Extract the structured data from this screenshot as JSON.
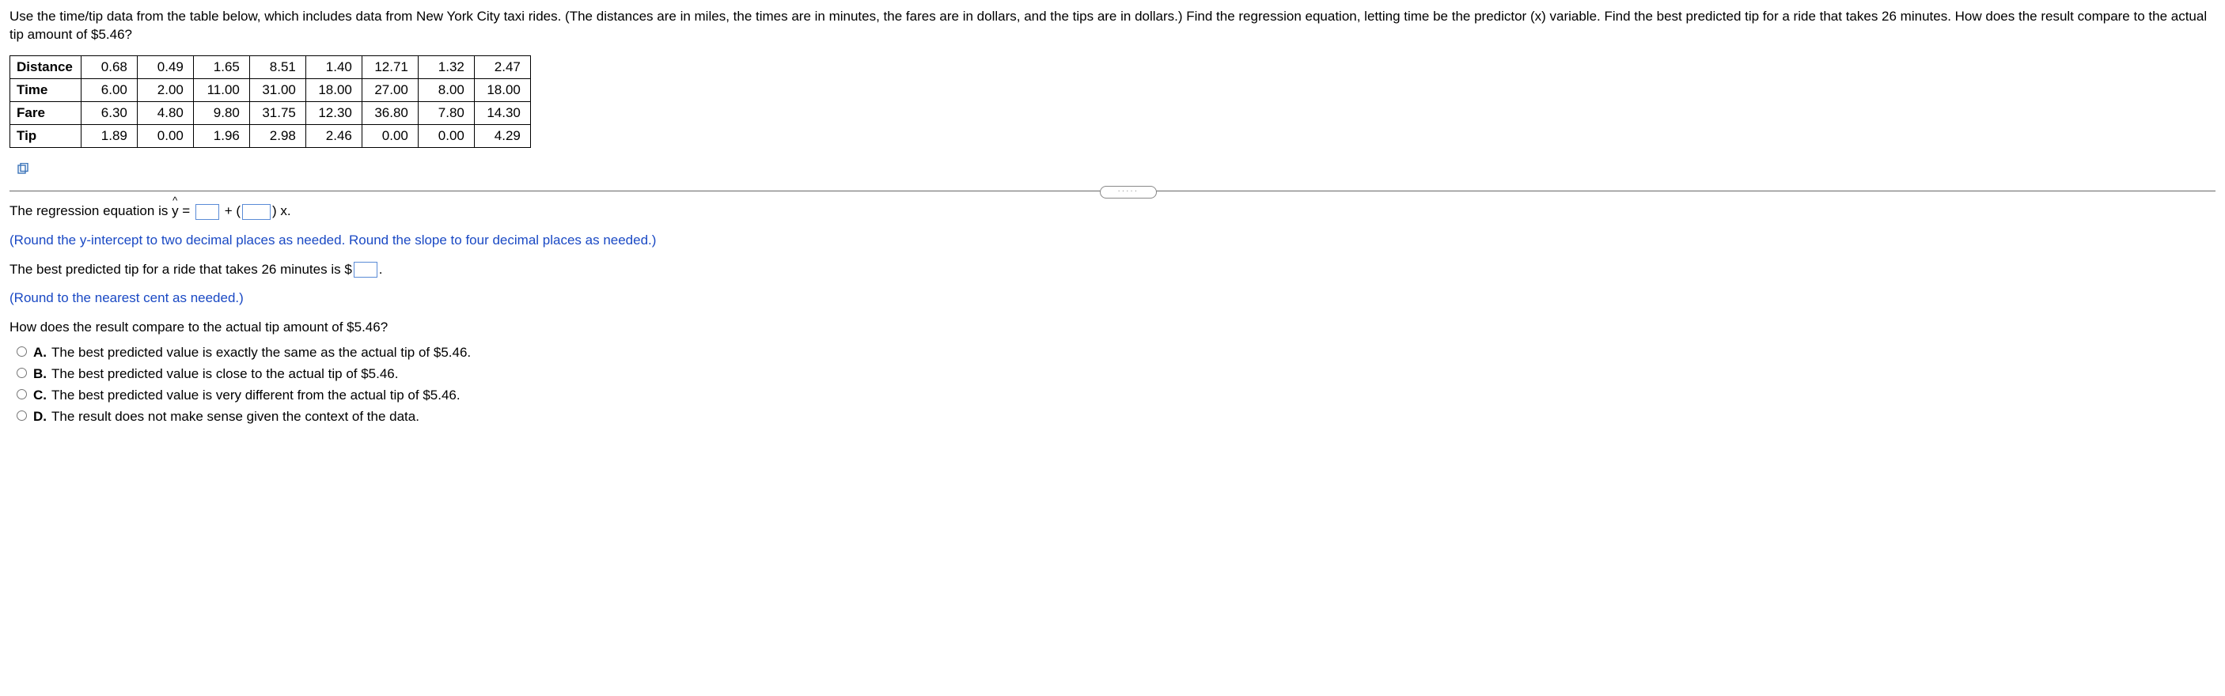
{
  "question": "Use the time/tip data from the table below, which includes data from New York City taxi rides. (The distances are in miles, the times are in minutes, the fares are in dollars, and the tips are in dollars.) Find the regression equation, letting time be the predictor (x) variable. Find the best predicted tip for a ride that takes 26 minutes. How does the result compare to the actual tip amount of $5.46?",
  "table": {
    "rows": [
      "Distance",
      "Time",
      "Fare",
      "Tip"
    ],
    "data": {
      "Distance": [
        "0.68",
        "0.49",
        "1.65",
        "8.51",
        "1.40",
        "12.71",
        "1.32",
        "2.47"
      ],
      "Time": [
        "6.00",
        "2.00",
        "11.00",
        "31.00",
        "18.00",
        "27.00",
        "8.00",
        "18.00"
      ],
      "Fare": [
        "6.30",
        "4.80",
        "9.80",
        "31.75",
        "12.30",
        "36.80",
        "7.80",
        "14.30"
      ],
      "Tip": [
        "1.89",
        "0.00",
        "1.96",
        "2.98",
        "2.46",
        "0.00",
        "0.00",
        "4.29"
      ]
    }
  },
  "eq": {
    "prefix": "The regression equation is ",
    "eq_sym": "=",
    "plus": " + ",
    "x": " x.",
    "hint": "(Round the y-intercept to two decimal places as needed. Round the slope to four decimal places as needed.)"
  },
  "pred": {
    "text1": "The best predicted tip for a ride that takes 26 minutes is $",
    "text2": ".",
    "hint": "(Round to the nearest cent as needed.)"
  },
  "compare": "How does the result compare to the actual tip amount of $5.46?",
  "options": {
    "A": "The best predicted value is exactly the same as the actual tip of $5.46.",
    "B": "The best predicted value is close to the actual tip of $5.46.",
    "C": "The best predicted value is very different from the actual tip of $5.46.",
    "D": "The result does not make sense given the context of the data."
  },
  "chart_data": {
    "type": "table",
    "note": "NYC taxi rides sample; distances in miles, times in minutes, fares and tips in dollars",
    "columns": [
      "Distance",
      "Time",
      "Fare",
      "Tip"
    ],
    "records": [
      {
        "Distance": 0.68,
        "Time": 6.0,
        "Fare": 6.3,
        "Tip": 1.89
      },
      {
        "Distance": 0.49,
        "Time": 2.0,
        "Fare": 4.8,
        "Tip": 0.0
      },
      {
        "Distance": 1.65,
        "Time": 11.0,
        "Fare": 9.8,
        "Tip": 1.96
      },
      {
        "Distance": 8.51,
        "Time": 31.0,
        "Fare": 31.75,
        "Tip": 2.98
      },
      {
        "Distance": 1.4,
        "Time": 18.0,
        "Fare": 12.3,
        "Tip": 2.46
      },
      {
        "Distance": 12.71,
        "Time": 27.0,
        "Fare": 36.8,
        "Tip": 0.0
      },
      {
        "Distance": 1.32,
        "Time": 8.0,
        "Fare": 7.8,
        "Tip": 0.0
      },
      {
        "Distance": 2.47,
        "Time": 18.0,
        "Fare": 14.3,
        "Tip": 4.29
      }
    ]
  }
}
